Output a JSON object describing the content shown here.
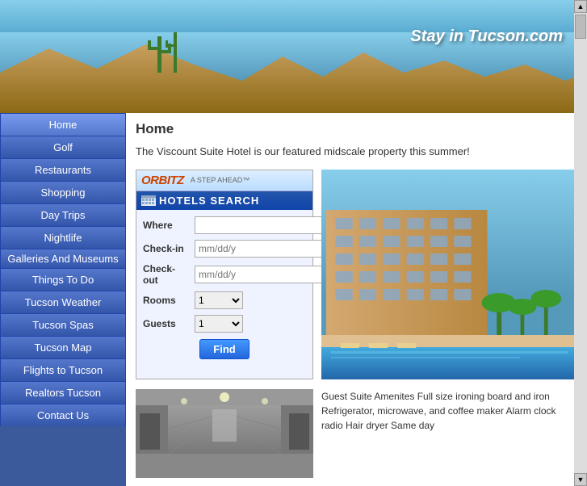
{
  "header": {
    "title": "Stay in Tucson",
    "subtitle": ".com"
  },
  "sidebar": {
    "items": [
      {
        "label": "Home",
        "active": true
      },
      {
        "label": "Golf",
        "active": false
      },
      {
        "label": "Restaurants",
        "active": false
      },
      {
        "label": "Shopping",
        "active": false
      },
      {
        "label": "Day Trips",
        "active": false
      },
      {
        "label": "Nightlife",
        "active": false
      },
      {
        "label": "Galleries And Museums",
        "active": false
      },
      {
        "label": "Things To Do",
        "active": false
      },
      {
        "label": "Tucson Weather",
        "active": false
      },
      {
        "label": "Tucson Spas",
        "active": false
      },
      {
        "label": "Tucson Map",
        "active": false
      },
      {
        "label": "Flights to Tucson",
        "active": false
      },
      {
        "label": "Realtors Tucson",
        "active": false
      },
      {
        "label": "Contact Us",
        "active": false
      }
    ]
  },
  "main": {
    "heading": "Home",
    "description": "The Viscount Suite Hotel is our featured midscale property this summer!",
    "orbitz": {
      "logo": "ORBITZ",
      "tagline": "A STEP AHEAD™",
      "search_label": "HOTELS SEARCH",
      "where_label": "Where",
      "checkin_label": "Check-in",
      "checkout_label": "Check-out",
      "rooms_label": "Rooms",
      "guests_label": "Guests",
      "checkin_placeholder": "mm/dd/y",
      "checkout_placeholder": "mm/dd/y",
      "rooms_default": "1",
      "guests_default": "1",
      "find_label": "Find"
    },
    "bottom_text": "Guest Suite Amenites Full size ironing board and iron Refrigerator, microwave, and coffee maker Alarm clock radio Hair dryer Same day"
  }
}
